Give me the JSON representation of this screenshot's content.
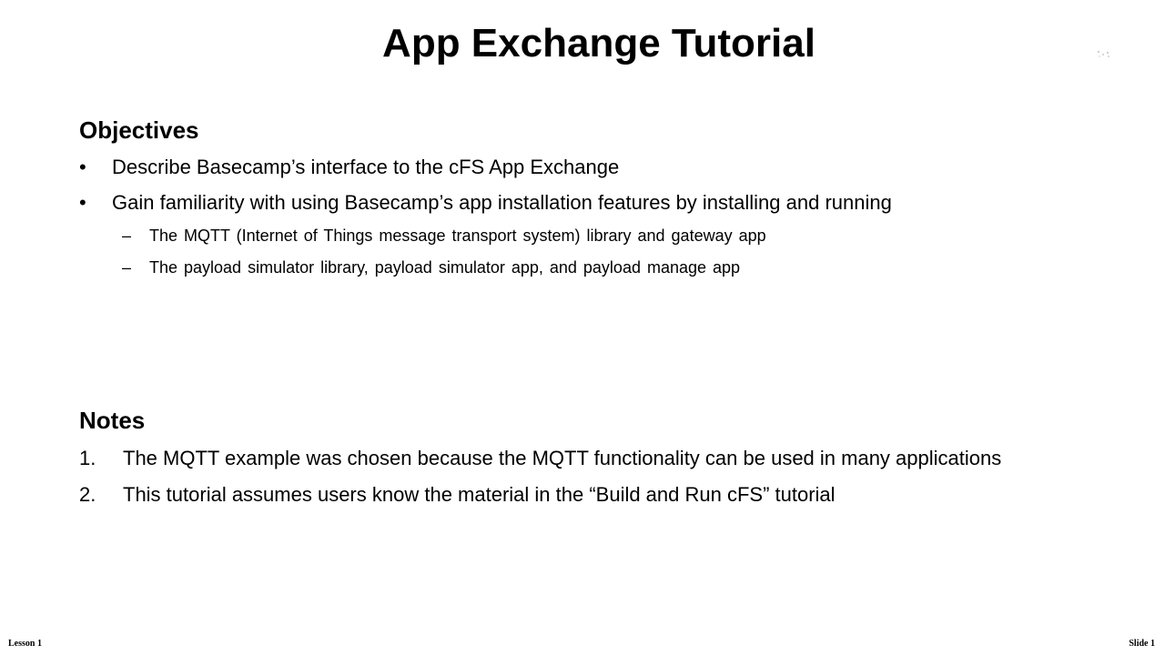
{
  "slide": {
    "title": "App Exchange Tutorial"
  },
  "objectives": {
    "heading": "Objectives",
    "items": [
      {
        "marker": "•",
        "text": "Describe Basecamp’s interface to the cFS App Exchange"
      },
      {
        "marker": "•",
        "text": "Gain familiarity with using Basecamp’s app installation features by installing and running",
        "subitems": [
          {
            "marker": "–",
            "text": "The MQTT (Internet of Things message transport system) library and gateway app"
          },
          {
            "marker": "–",
            "text": "The payload simulator library, payload simulator app, and payload manage app"
          }
        ]
      }
    ]
  },
  "notes": {
    "heading": "Notes",
    "items": [
      {
        "marker": "1.",
        "text": "The MQTT example was chosen because the MQTT functionality can be used in many applications"
      },
      {
        "marker": "2.",
        "text": "This tutorial assumes users know the material in the “Build and Run cFS” tutorial"
      }
    ]
  },
  "footer": {
    "left": "Lesson 1",
    "right": "Slide 1"
  },
  "colors": {
    "text": "#000000",
    "background": "#ffffff"
  }
}
